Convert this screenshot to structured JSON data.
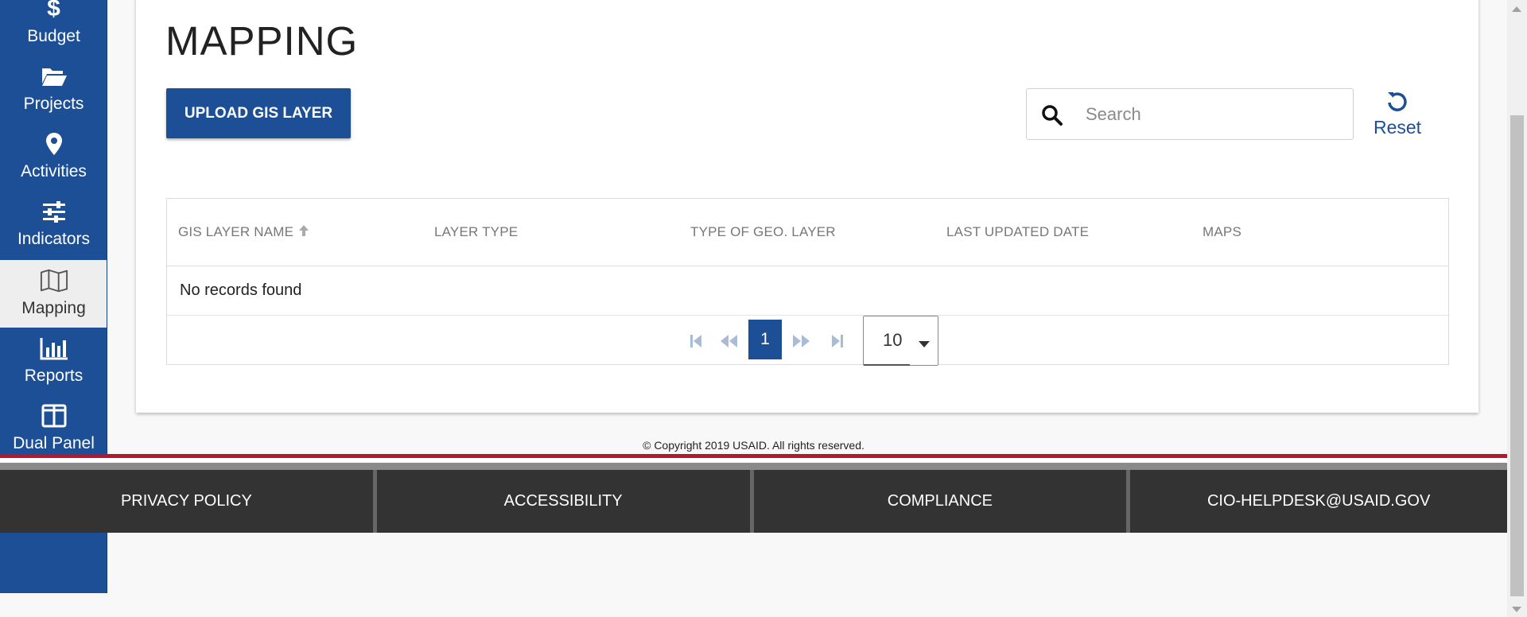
{
  "sidebar": {
    "items": [
      {
        "label": "Budget",
        "icon": "dollar-icon"
      },
      {
        "label": "Projects",
        "icon": "folder-open-icon"
      },
      {
        "label": "Activities",
        "icon": "map-marker-icon"
      },
      {
        "label": "Indicators",
        "icon": "sliders-icon"
      },
      {
        "label": "Mapping",
        "icon": "map-icon",
        "active": true
      },
      {
        "label": "Reports",
        "icon": "bar-chart-icon"
      },
      {
        "label": "Dual Panel",
        "icon": "columns-icon"
      }
    ]
  },
  "main": {
    "title": "MAPPING",
    "upload_button": "UPLOAD GIS LAYER",
    "search": {
      "placeholder": "Search",
      "value": ""
    },
    "reset_label": "Reset",
    "table": {
      "columns": [
        "GIS LAYER NAME",
        "LAYER TYPE",
        "TYPE OF GEO. LAYER",
        "LAST UPDATED DATE",
        "MAPS"
      ],
      "sorted_column": "GIS LAYER NAME",
      "empty_message": "No records found"
    },
    "pagination": {
      "current_page": "1",
      "page_size": "10"
    }
  },
  "footer": {
    "copyright": "© Copyright 2019 USAID. All rights reserved.",
    "links": [
      "PRIVACY POLICY",
      "ACCESSIBILITY",
      "COMPLIANCE",
      "CIO-HELPDESK@USAID.GOV"
    ]
  },
  "colors": {
    "brand_blue": "#1c4f95",
    "footer_bg": "#333333",
    "accent_red": "#b5172f"
  }
}
